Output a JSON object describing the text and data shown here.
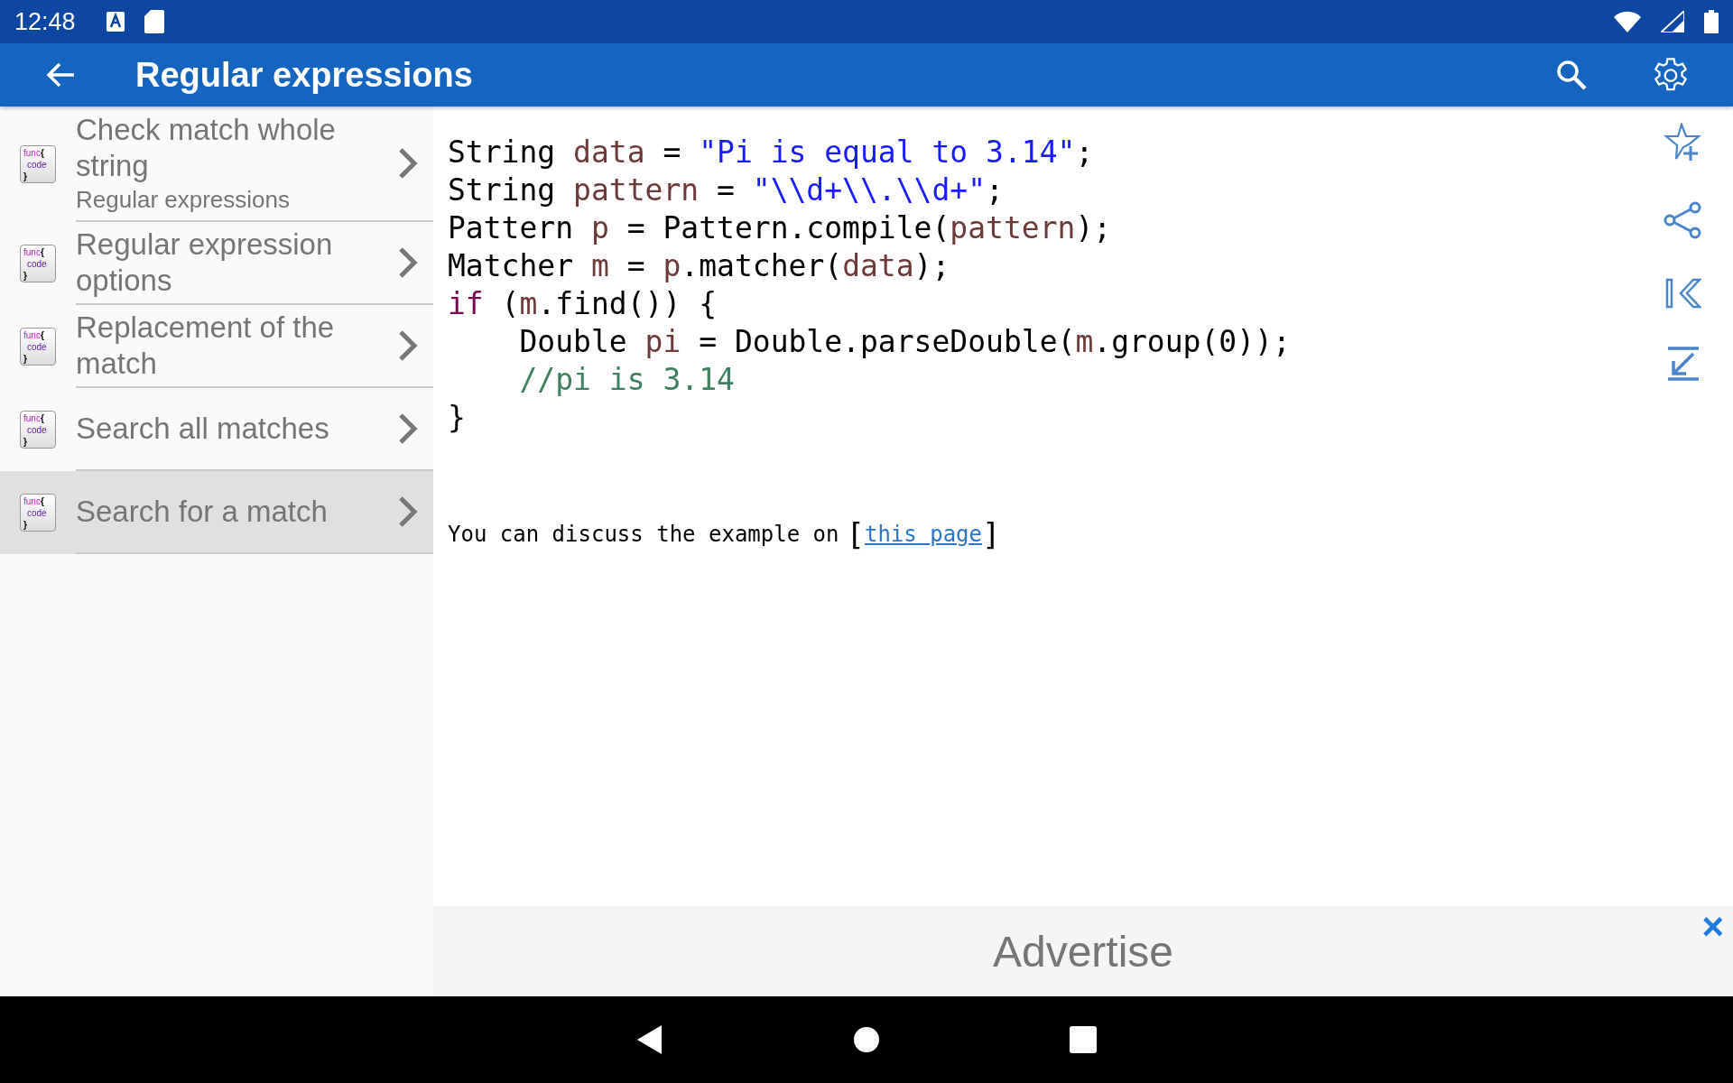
{
  "status_bar": {
    "time": "12:48"
  },
  "app_bar": {
    "title": "Regular expressions"
  },
  "list": [
    {
      "title": "Check match whole string",
      "subtitle": "Regular expressions",
      "icon_text": [
        "func",
        "{",
        "code",
        "}"
      ],
      "selected": false
    },
    {
      "title": "Regular expression options",
      "icon_text": [
        "func",
        "{",
        "code",
        "}"
      ],
      "selected": false
    },
    {
      "title": "Replacement of the match",
      "icon_text": [
        "func",
        "{",
        "code",
        "}"
      ],
      "selected": false
    },
    {
      "title": "Search all matches",
      "icon_text": [
        "func",
        "{",
        "code",
        "}"
      ],
      "selected": false
    },
    {
      "title": "Search for a match",
      "icon_text": [
        "func",
        "{",
        "code",
        "}"
      ],
      "selected": true
    }
  ],
  "code": [
    [
      {
        "kind": "plain",
        "text": "String "
      },
      {
        "kind": "var",
        "text": "data"
      },
      {
        "kind": "plain",
        "text": " = "
      },
      {
        "kind": "string",
        "text": "\"Pi is equal to 3.14\""
      },
      {
        "kind": "plain",
        "text": ";"
      }
    ],
    [
      {
        "kind": "plain",
        "text": "String "
      },
      {
        "kind": "var",
        "text": "pattern"
      },
      {
        "kind": "plain",
        "text": " = "
      },
      {
        "kind": "string",
        "text": "\"\\\\d+\\\\.\\\\d+\""
      },
      {
        "kind": "plain",
        "text": ";"
      }
    ],
    [
      {
        "kind": "plain",
        "text": "Pattern "
      },
      {
        "kind": "var",
        "text": "p"
      },
      {
        "kind": "plain",
        "text": " = Pattern.compile("
      },
      {
        "kind": "var",
        "text": "pattern"
      },
      {
        "kind": "plain",
        "text": ");"
      }
    ],
    [
      {
        "kind": "plain",
        "text": "Matcher "
      },
      {
        "kind": "var",
        "text": "m"
      },
      {
        "kind": "plain",
        "text": " = "
      },
      {
        "kind": "var",
        "text": "p"
      },
      {
        "kind": "plain",
        "text": ".matcher("
      },
      {
        "kind": "var",
        "text": "data"
      },
      {
        "kind": "plain",
        "text": ");"
      }
    ],
    [
      {
        "kind": "keyword",
        "text": "if"
      },
      {
        "kind": "plain",
        "text": " ("
      },
      {
        "kind": "var",
        "text": "m"
      },
      {
        "kind": "plain",
        "text": ".find()) {"
      }
    ],
    [
      {
        "kind": "plain",
        "text": "    Double "
      },
      {
        "kind": "var",
        "text": "pi"
      },
      {
        "kind": "plain",
        "text": " = Double.parseDouble("
      },
      {
        "kind": "var",
        "text": "m"
      },
      {
        "kind": "plain",
        "text": ".group(0));"
      }
    ],
    [
      {
        "kind": "comment",
        "text": "    //pi is 3.14"
      }
    ],
    [
      {
        "kind": "plain",
        "text": "}"
      }
    ]
  ],
  "discussion": {
    "text": "You can discuss the example on",
    "open_bracket": "[",
    "link": "this page",
    "close_bracket": "]"
  },
  "ad": {
    "text": "Advertise",
    "close": "×"
  }
}
